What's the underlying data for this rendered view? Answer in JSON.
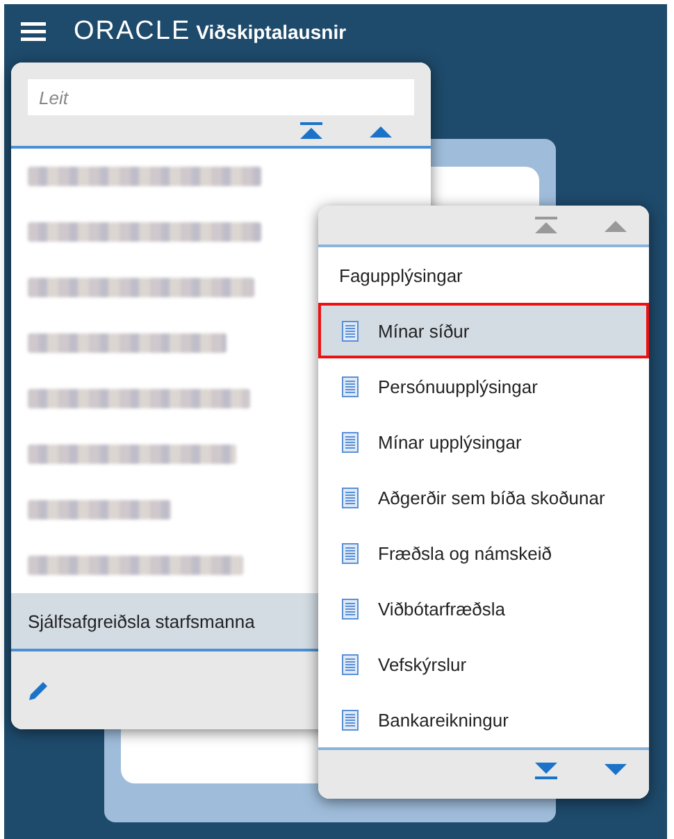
{
  "header": {
    "brand": "ORACLE",
    "title": "Viðskiptalausnir"
  },
  "main_menu": {
    "search": {
      "placeholder": "Leit"
    },
    "top_scroll": [
      {
        "kind": "first",
        "disabled": false
      },
      {
        "kind": "up",
        "disabled": false
      }
    ],
    "items": [
      {
        "kind": "redacted",
        "selected": false
      },
      {
        "kind": "redacted",
        "selected": false
      },
      {
        "kind": "redacted",
        "selected": false
      },
      {
        "kind": "redacted",
        "selected": false
      },
      {
        "kind": "redacted",
        "selected": false
      },
      {
        "kind": "redacted",
        "selected": false
      },
      {
        "kind": "redacted",
        "selected": false
      },
      {
        "kind": "redacted",
        "selected": false
      },
      {
        "kind": "text",
        "label": "Sjálfsafgreiðsla starfsmanna",
        "selected": true
      }
    ]
  },
  "submenu": {
    "top_scroll": [
      {
        "kind": "first",
        "disabled": true
      },
      {
        "kind": "up",
        "disabled": true
      }
    ],
    "heading": "Fagupplýsingar",
    "items": [
      {
        "label": "Mínar síður",
        "selected": true
      },
      {
        "label": "Persónuupplýsingar",
        "selected": false
      },
      {
        "label": "Mínar upplýsingar",
        "selected": false
      },
      {
        "label": "Aðgerðir sem bíða skoðunar",
        "selected": false
      },
      {
        "label": "Fræðsla og námskeið",
        "selected": false
      },
      {
        "label": "Viðbótarfræðsla",
        "selected": false
      },
      {
        "label": "Vefskýrslur",
        "selected": false
      },
      {
        "label": "Bankareikningur",
        "selected": false
      }
    ],
    "bottom_scroll": [
      {
        "kind": "last",
        "disabled": false
      },
      {
        "kind": "down",
        "disabled": false
      }
    ]
  }
}
